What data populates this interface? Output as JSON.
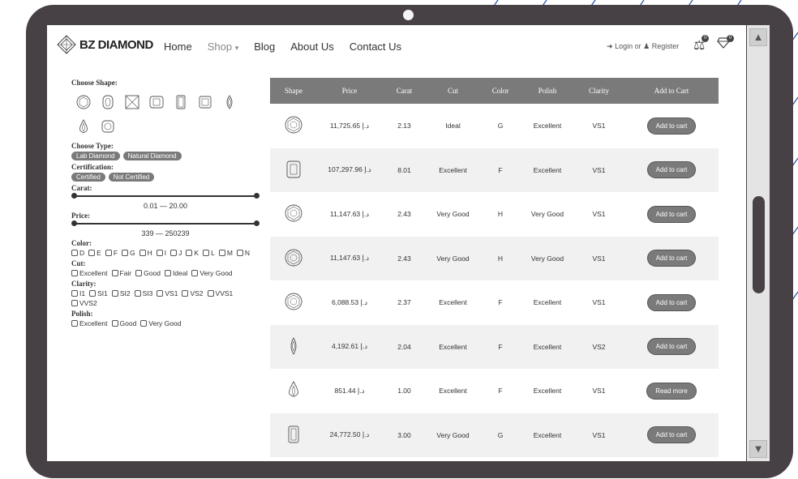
{
  "header": {
    "logo_text": "BZ DIAMOND",
    "nav": [
      "Home",
      "Shop",
      "Blog",
      "About Us",
      "Contact Us"
    ],
    "login": "Login",
    "or": "or",
    "register": "Register",
    "compare_count": "0",
    "wishlist_count": "0"
  },
  "filters": {
    "shape_label": "Choose Shape:",
    "shapes": [
      "round-icon",
      "cushion-icon",
      "asscher-icon",
      "radiant-icon",
      "emerald-icon",
      "princess-icon",
      "marquise-icon",
      "pear-icon",
      "oval-icon"
    ],
    "type_label": "Choose Type:",
    "types": [
      "Lab Diamond",
      "Natural Diamond"
    ],
    "cert_label": "Certification:",
    "certs": [
      "Certified",
      "Not Certified"
    ],
    "carat_label": "Carat:",
    "carat_range": "0.01 — 20.00",
    "price_label": "Price:",
    "price_range": "339 — 250239",
    "color_label": "Color:",
    "colors": [
      "D",
      "E",
      "F",
      "G",
      "H",
      "I",
      "J",
      "K",
      "L",
      "M",
      "N"
    ],
    "cut_label": "Cut:",
    "cuts": [
      "Excellent",
      "Fair",
      "Good",
      "Ideal",
      "Very Good"
    ],
    "clarity_label": "Clarity:",
    "clarities": [
      "I1",
      "SI1",
      "SI2",
      "SI3",
      "VS1",
      "VS2",
      "VVS1",
      "VVS2"
    ],
    "polish_label": "Polish:",
    "polishes": [
      "Excellent",
      "Good",
      "Very Good"
    ]
  },
  "table": {
    "headers": [
      "Shape",
      "Price",
      "Carat",
      "Cut",
      "Color",
      "Polish",
      "Clarity",
      "Add to Cart"
    ],
    "rows": [
      {
        "shape": "round-icon",
        "price": "11,725.65 د.إ",
        "carat": "2.13",
        "cut": "Ideal",
        "color": "G",
        "polish": "Excellent",
        "clarity": "VS1",
        "action": "Add to cart"
      },
      {
        "shape": "radiant-icon",
        "price": "107,297.96 د.إ",
        "carat": "8.01",
        "cut": "Excellent",
        "color": "F",
        "polish": "Excellent",
        "clarity": "VS1",
        "action": "Add to cart"
      },
      {
        "shape": "round-icon",
        "price": "11,147.63 د.إ",
        "carat": "2.43",
        "cut": "Very Good",
        "color": "H",
        "polish": "Very Good",
        "clarity": "VS1",
        "action": "Add to cart"
      },
      {
        "shape": "round-icon",
        "price": "11,147.63 د.إ",
        "carat": "2.43",
        "cut": "Very Good",
        "color": "H",
        "polish": "Very Good",
        "clarity": "VS1",
        "action": "Add to cart"
      },
      {
        "shape": "round-icon",
        "price": "6,088.53 د.إ",
        "carat": "2.37",
        "cut": "Excellent",
        "color": "F",
        "polish": "Excellent",
        "clarity": "VS1",
        "action": "Add to cart"
      },
      {
        "shape": "oval-icon",
        "price": "4,192.61 د.إ",
        "carat": "2.04",
        "cut": "Excellent",
        "color": "F",
        "polish": "Excellent",
        "clarity": "VS2",
        "action": "Add to cart"
      },
      {
        "shape": "pear-icon",
        "price": "851.44 د.إ",
        "carat": "1.00",
        "cut": "Excellent",
        "color": "F",
        "polish": "Excellent",
        "clarity": "VS1",
        "action": "Read more"
      },
      {
        "shape": "emerald-icon",
        "price": "24,772.50 د.إ",
        "carat": "3.00",
        "cut": "Very Good",
        "color": "G",
        "polish": "Excellent",
        "clarity": "VS1",
        "action": "Add to cart"
      }
    ]
  },
  "colors": {
    "frame": "#474145",
    "accent": "#7a7a7a",
    "stripe_lines": "#1e4fa8"
  }
}
